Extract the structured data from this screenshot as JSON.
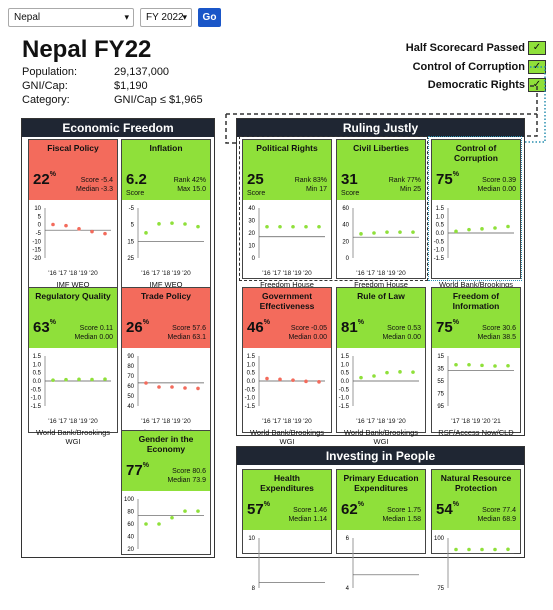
{
  "controls": {
    "country": "Nepal",
    "year": "FY 2022",
    "go_label": "Go"
  },
  "title": "Nepal FY22",
  "meta": [
    {
      "label": "Population:",
      "value": "29,137,000"
    },
    {
      "label": "GNI/Cap:",
      "value": "$1,190"
    },
    {
      "label": "Category:",
      "value": "GNI/Cap ≤ $1,965"
    }
  ],
  "legend": [
    {
      "label": "Half Scorecard Passed",
      "mark": "✓"
    },
    {
      "label": "Control of Corruption",
      "mark": "✓"
    },
    {
      "label": "Democratic Rights",
      "mark": "✓"
    }
  ],
  "sections": {
    "econ": "Economic Freedom",
    "ruling": "Ruling Justly",
    "invest": "Investing in People"
  },
  "cards": [
    {
      "id": "fiscal",
      "name": "Fiscal Policy",
      "status": "red",
      "big": "22",
      "unit": "%",
      "s1": "Score -5.4",
      "s2": "Median -3.3",
      "src": "IMF WEO",
      "ticks": [
        "10",
        "5",
        "0",
        "-5",
        "-10",
        "-15",
        "-20"
      ],
      "years": "'16 '17 '18 '19 '20",
      "points": [
        0.1,
        -0.6,
        -2.5,
        -4.2,
        -5.4
      ],
      "ymin": -20,
      "ymax": 10,
      "median": -3.3,
      "color": "#f36b5c"
    },
    {
      "id": "inflation",
      "name": "Inflation",
      "status": "green",
      "big": "6.2",
      "unit": "",
      "lbl": "Score",
      "s1": "Rank 42%",
      "s2": "Max 15.0",
      "src": "IMF WEO",
      "ticks": [
        "-5",
        "5",
        "15",
        "25"
      ],
      "years": "'16 '17 '18 '19 '20",
      "points": [
        9.9,
        4.5,
        4.1,
        4.6,
        6.2
      ],
      "ymin": -5,
      "ymax": 25,
      "median": 15,
      "color": "#8fe03a",
      "invert": true
    },
    {
      "id": "political",
      "name": "Political Rights",
      "status": "green",
      "big": "25",
      "unit": "",
      "lbl": "Score",
      "s1": "Rank 83%",
      "s2": "Min 17",
      "src": "Freedom House",
      "ticks": [
        "40",
        "30",
        "20",
        "10",
        "0"
      ],
      "years": "'16 '17 '18 '19 '20",
      "points": [
        25,
        25,
        25,
        25,
        25
      ],
      "ymin": 0,
      "ymax": 40,
      "median": 17,
      "color": "#8fe03a"
    },
    {
      "id": "civil",
      "name": "Civil Liberties",
      "status": "green",
      "big": "31",
      "unit": "",
      "lbl": "Score",
      "s1": "Rank 77%",
      "s2": "Min 25",
      "src": "Freedom House",
      "ticks": [
        "60",
        "40",
        "20",
        "0"
      ],
      "years": "'16 '17 '18 '19 '20",
      "points": [
        29,
        30,
        31,
        31,
        31
      ],
      "ymin": 0,
      "ymax": 60,
      "median": 25,
      "color": "#8fe03a"
    },
    {
      "id": "corruption",
      "name": "Control of Corruption",
      "status": "green",
      "big": "75",
      "unit": "%",
      "s1": "Score 0.39",
      "s2": "Median 0.00",
      "src": "World Bank/Brookings WGI",
      "ticks": [
        "1.5",
        "1.0",
        "0.5",
        "0.0",
        "-0.5",
        "-1.0",
        "-1.5"
      ],
      "years": "",
      "points": [
        0.1,
        0.2,
        0.25,
        0.3,
        0.39
      ],
      "ymin": -1.5,
      "ymax": 1.5,
      "median": 0,
      "color": "#8fe03a"
    },
    {
      "id": "regulatory",
      "name": "Regulatory Quality",
      "status": "green",
      "big": "63",
      "unit": "%",
      "s1": "Score 0.11",
      "s2": "Median 0.00",
      "src": "World Bank/Brookings WGI",
      "ticks": [
        "1.5",
        "1.0",
        "0.5",
        "0.0",
        "-0.5",
        "-1.0",
        "-1.5"
      ],
      "years": "'16 '17 '18 '19 '20",
      "points": [
        0.05,
        0.08,
        0.1,
        0.09,
        0.11
      ],
      "ymin": -1.5,
      "ymax": 1.5,
      "median": 0,
      "color": "#8fe03a"
    },
    {
      "id": "trade",
      "name": "Trade Policy",
      "status": "red",
      "big": "26",
      "unit": "%",
      "s1": "Score 57.6",
      "s2": "Median 63.1",
      "src": "Heritage Foundation",
      "ticks": [
        "90",
        "80",
        "70",
        "60",
        "50",
        "40"
      ],
      "years": "'16 '17 '18 '19 '20",
      "points": [
        63,
        59,
        59,
        58,
        57.6
      ],
      "ymin": 40,
      "ymax": 90,
      "median": 63.1,
      "color": "#f36b5c"
    },
    {
      "id": "govt",
      "name": "Government Effectiveness",
      "status": "red",
      "big": "46",
      "unit": "%",
      "s1": "Score -0.05",
      "s2": "Median 0.00",
      "src": "World Bank/Brookings WGI",
      "ticks": [
        "1.5",
        "1.0",
        "0.5",
        "0.0",
        "-0.5",
        "-1.0",
        "-1.5"
      ],
      "years": "'16 '17 '18 '19 '20",
      "points": [
        0.15,
        0.1,
        0.05,
        -0.02,
        -0.05
      ],
      "ymin": -1.5,
      "ymax": 1.5,
      "median": 0,
      "color": "#f36b5c"
    },
    {
      "id": "law",
      "name": "Rule of Law",
      "status": "green",
      "big": "81",
      "unit": "%",
      "s1": "Score 0.53",
      "s2": "Median 0.00",
      "src": "World Bank/Brookings WGI",
      "ticks": [
        "1.5",
        "1.0",
        "0.5",
        "0.0",
        "-0.5",
        "-1.0",
        "-1.5"
      ],
      "years": "'16 '17 '18 '19 '20",
      "points": [
        0.2,
        0.3,
        0.5,
        0.55,
        0.53
      ],
      "ymin": -1.5,
      "ymax": 1.5,
      "median": 0,
      "color": "#8fe03a"
    },
    {
      "id": "info",
      "name": "Freedom of Information",
      "status": "green",
      "big": "75",
      "unit": "%",
      "s1": "Score 30.6",
      "s2": "Median 38.5",
      "src": "RSF/Access Now/CLD",
      "ticks": [
        "15",
        "35",
        "55",
        "75",
        "95"
      ],
      "years": "'17 '18 '19 '20 '21",
      "points": [
        29,
        29,
        30,
        31,
        30.6
      ],
      "ymin": 15,
      "ymax": 95,
      "median": 38.5,
      "color": "#8fe03a",
      "invert": true
    },
    {
      "id": "gender",
      "name": "Gender in the Economy",
      "status": "green",
      "big": "77",
      "unit": "%",
      "s1": "Score 80.6",
      "s2": "Median 73.9",
      "src": "",
      "ticks": [
        "100",
        "80",
        "60",
        "40",
        "20"
      ],
      "years": "",
      "points": [
        60,
        60,
        70,
        80.6,
        80.6
      ],
      "ymin": 20,
      "ymax": 100,
      "median": 73.9,
      "color": "#8fe03a"
    },
    {
      "id": "health",
      "name": "Health Expenditures",
      "status": "green",
      "big": "57",
      "unit": "%",
      "s1": "Score 1.46",
      "s2": "Median 1.14",
      "src": "",
      "ticks": [
        "10",
        "8"
      ],
      "years": "",
      "points": [],
      "ymin": 0,
      "ymax": 10,
      "median": 1.14,
      "color": "#8fe03a"
    },
    {
      "id": "education",
      "name": "Primary Education Expenditures",
      "status": "green",
      "big": "62",
      "unit": "%",
      "s1": "Score 1.75",
      "s2": "Median 1.58",
      "src": "",
      "ticks": [
        "6",
        "4"
      ],
      "years": "",
      "points": [],
      "ymin": 0,
      "ymax": 6,
      "median": 1.58,
      "color": "#8fe03a"
    },
    {
      "id": "natural",
      "name": "Natural Resource Protection",
      "status": "green",
      "big": "54",
      "unit": "%",
      "s1": "Score 77.4",
      "s2": "Median 68.9",
      "src": "",
      "ticks": [
        "100",
        "75"
      ],
      "years": "",
      "points": [
        77,
        77,
        77,
        77,
        77.4
      ],
      "ymin": 0,
      "ymax": 100,
      "median": 68.9,
      "color": "#8fe03a"
    }
  ]
}
